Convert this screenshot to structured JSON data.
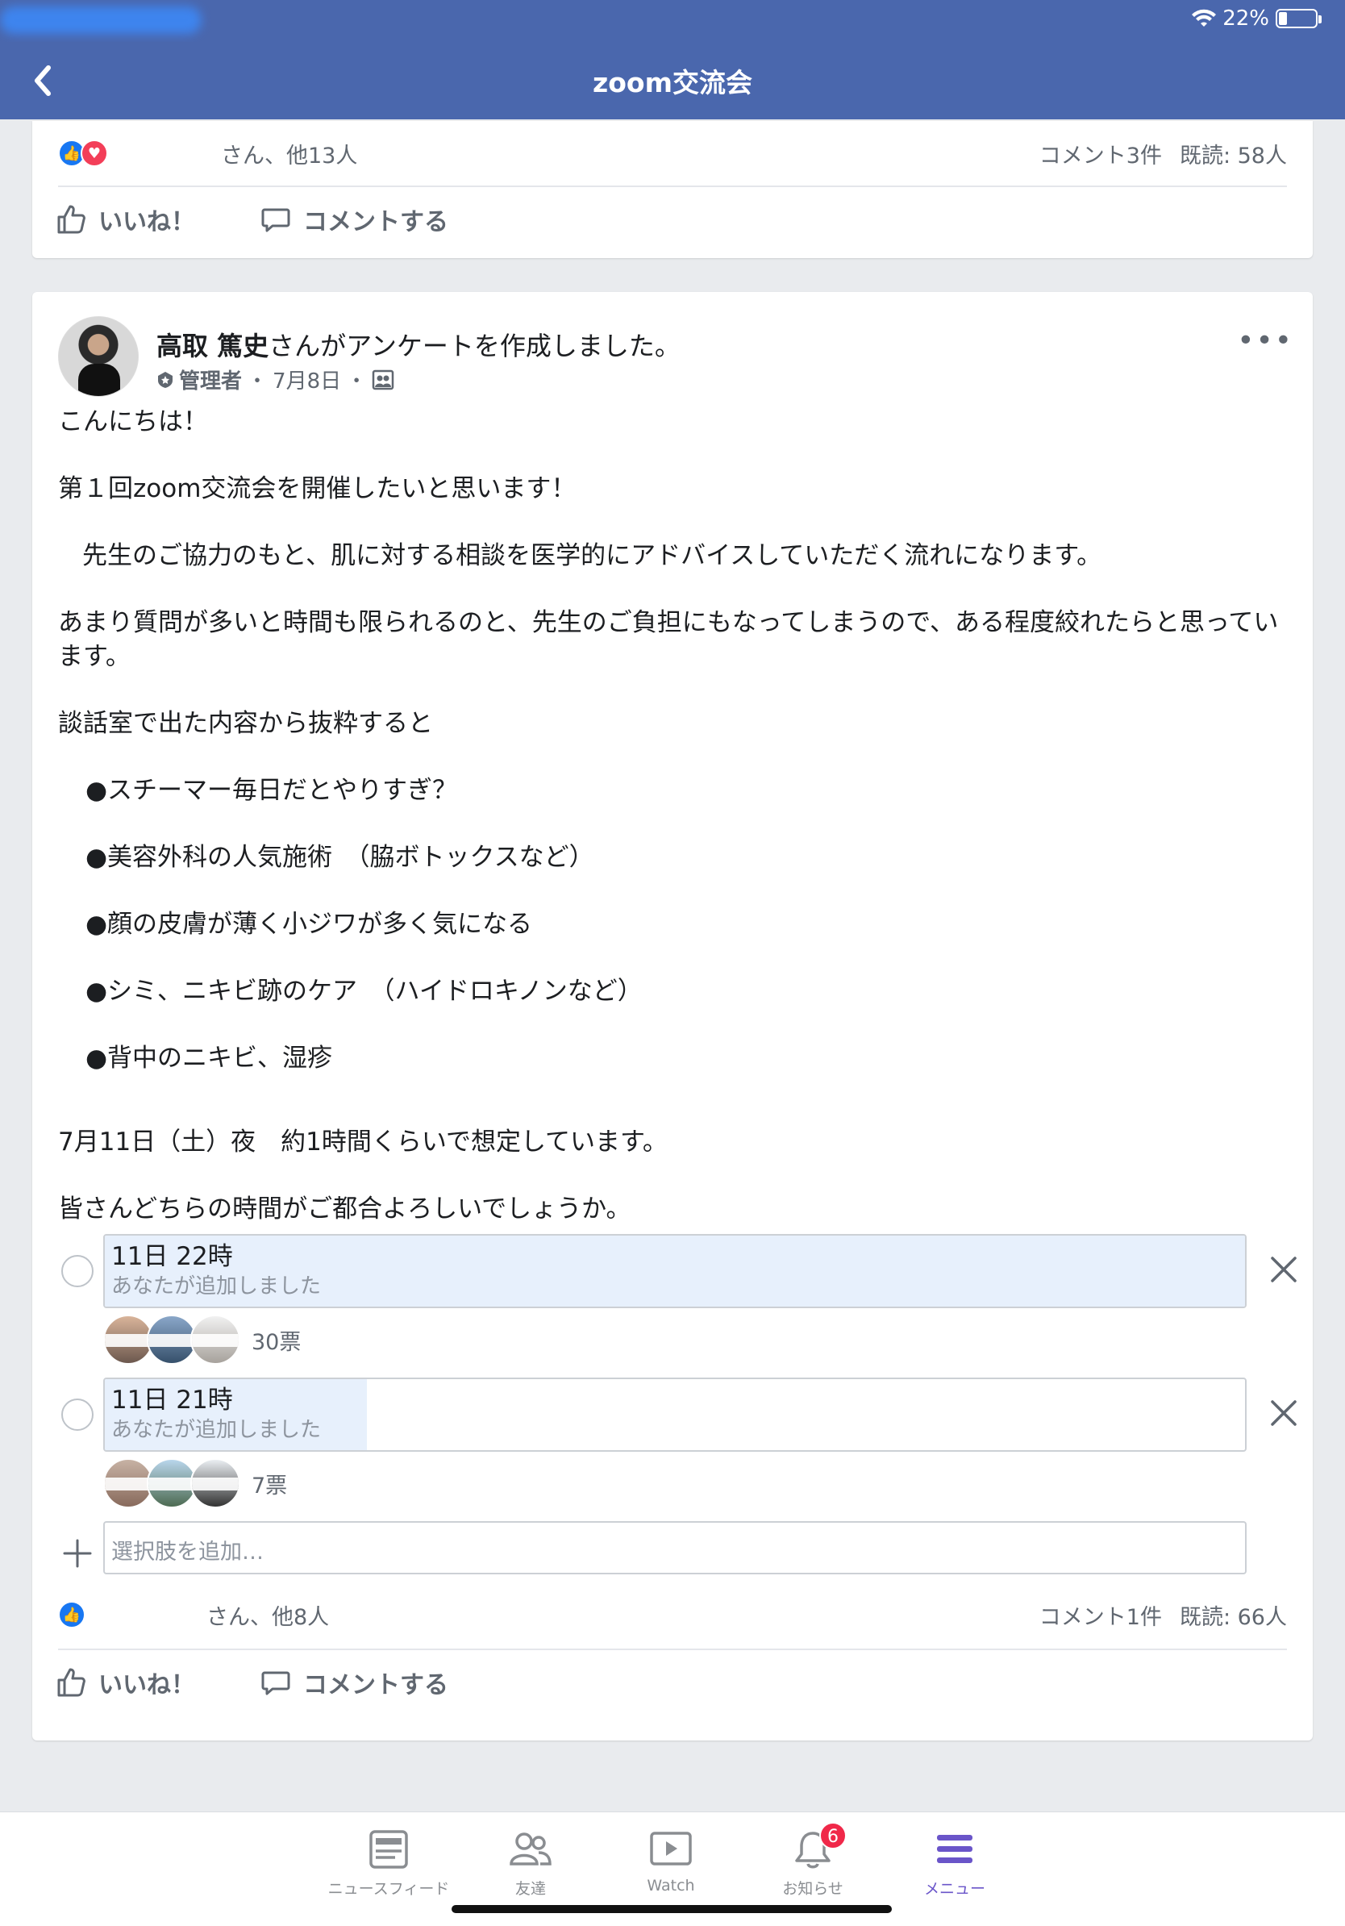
{
  "status_bar": {
    "battery": "22%",
    "battery_level": 0.22
  },
  "nav": {
    "title": "zoom交流会"
  },
  "prev_post": {
    "reactions_text": "さん、他13人",
    "comments": "コメント3件",
    "seen": "既読: 58人",
    "like_label": "いいね！",
    "comment_label": "コメントする"
  },
  "post": {
    "author": "高取 篤史",
    "action_text": "さんがアンケートを作成しました。",
    "role": "管理者",
    "date": "7月8日",
    "sep": "・",
    "more": "•••",
    "body": {
      "p1": "こんにちは！",
      "p2": "第１回zoom交流会を開催したいと思います！",
      "p3": "先生のご協力のもと、肌に対する相談を医学的にアドバイスしていただく流れになります。",
      "p4": "あまり質問が多いと時間も限られるのと、先生のご負担にもなってしまうので、ある程度絞れたらと思っています。",
      "p5": "談話室で出た内容から抜粋すると",
      "bullets": [
        "●スチーマー毎日だとやりすぎ？",
        "●美容外科の人気施術　（脇ボトックスなど）",
        "●顔の皮膚が薄く小ジワが多く気になる",
        "●シミ、ニキビ跡のケア　（ハイドロキノンなど）",
        "●背中のニキビ、湿疹"
      ],
      "p6": "7月11日（土）夜　約1時間くらいで想定しています。",
      "p7": "皆さんどちらの時間がご都合よろしいでしょうか。"
    },
    "poll": {
      "options": [
        {
          "label": "11日 22時",
          "sub": "あなたが追加しました",
          "votes": "30票",
          "share": 1.0
        },
        {
          "label": "11日 21時",
          "sub": "あなたが追加しました",
          "votes": "7票",
          "share": 0.23
        }
      ],
      "add_placeholder": "選択肢を追加…"
    },
    "reactions_text": "さん、他8人",
    "comments": "コメント1件",
    "seen": "既読: 66人",
    "like_label": "いいね！",
    "comment_label": "コメントする"
  },
  "tabs": [
    {
      "label": "ニュースフィード",
      "icon": "news-feed-icon"
    },
    {
      "label": "友達",
      "icon": "friends-icon"
    },
    {
      "label": "Watch",
      "icon": "watch-icon"
    },
    {
      "label": "お知らせ",
      "icon": "bell-icon",
      "badge": "6"
    },
    {
      "label": "メニュー",
      "icon": "menu-icon",
      "active": true
    }
  ],
  "colors": {
    "header": "#4a67ad",
    "like": "#1877f2",
    "love": "#f33e58",
    "poll_fill": "#e7f0fc",
    "active_tab": "#6a55c9",
    "badge": "#f02849"
  }
}
